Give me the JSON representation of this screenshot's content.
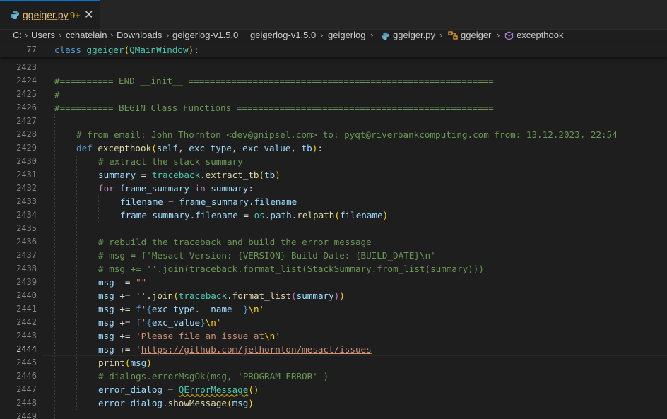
{
  "tab": {
    "filename": "ggeiger.py",
    "problems": "9+",
    "close": "✕"
  },
  "breadcrumb": {
    "segments": [
      "C:",
      "Users",
      "cchatelain",
      "Downloads",
      "geigerlog-v1.5.0",
      "geigerlog-v1.5.0",
      "geigerlog",
      "ggeiger.py",
      "ggeiger",
      "excepthook"
    ],
    "separator": "›"
  },
  "sticky": {
    "line_number": "77",
    "keyword": "class",
    "name": "ggeiger",
    "base": "QMainWindow",
    "open": "(",
    "close": "):"
  },
  "lines": {
    "l2423": {
      "n": "2423"
    },
    "l2424": {
      "n": "2424",
      "text": "#========== END __init__ ========================================================="
    },
    "l2425": {
      "n": "2425",
      "text": "#"
    },
    "l2426": {
      "n": "2426",
      "text": "#========== BEGIN Class Functions ================================================"
    },
    "l2427": {
      "n": "2427"
    },
    "l2428": {
      "n": "2428",
      "text": "# from email: John Thornton <dev@gnipsel.com> to: pyqt@riverbankcomputing.com from: 13.12.2023, 22:54"
    },
    "l2429": {
      "n": "2429",
      "def": "def",
      "name": "excepthook",
      "p1": "self",
      "p2": "exc_type",
      "p3": "exc_value",
      "p4": "tb"
    },
    "l2430": {
      "n": "2430",
      "text": "# extract the stack summary"
    },
    "l2431": {
      "n": "2431",
      "var": "summary",
      "mod": "traceback",
      "fn": "extract_tb",
      "arg": "tb"
    },
    "l2432": {
      "n": "2432",
      "for": "for",
      "var": "frame_summary",
      "in": "in",
      "iter": "summary"
    },
    "l2433": {
      "n": "2433",
      "a": "filename",
      "b": "frame_summary",
      "c": "filename"
    },
    "l2434": {
      "n": "2434",
      "a": "frame_summary",
      "b": "filename",
      "mod1": "os",
      "mod2": "path",
      "fn": "relpath",
      "arg": "filename"
    },
    "l2435": {
      "n": "2435"
    },
    "l2436": {
      "n": "2436",
      "text": "# rebuild the traceback and build the error message"
    },
    "l2437": {
      "n": "2437",
      "text": "# msg = f'Mesact Version: {VERSION} Build Date: {BUILD_DATE}\\n'"
    },
    "l2438": {
      "n": "2438",
      "text": "# msg += ''.join(traceback.format_list(StackSummary.from_list(summary)))"
    },
    "l2439": {
      "n": "2439",
      "var": "msg",
      "str": "\"\""
    },
    "l2440": {
      "n": "2440",
      "var": "msg",
      "str": "''",
      "fn1": "join",
      "mod": "traceback",
      "fn2": "format_list",
      "arg": "summary"
    },
    "l2441": {
      "n": "2441",
      "var": "msg",
      "f": "f",
      "q1": "'",
      "expr": "exc_type",
      "attr": "__name__",
      "esc": "\\n",
      "q2": "'"
    },
    "l2442": {
      "n": "2442",
      "var": "msg",
      "f": "f",
      "q1": "'",
      "expr": "exc_value",
      "esc": "\\n",
      "q2": "'"
    },
    "l2443": {
      "n": "2443",
      "var": "msg",
      "str": "'Please file an issue at",
      "esc": "\\n",
      "q2": "'"
    },
    "l2444": {
      "n": "2444",
      "var": "msg",
      "q1": "'",
      "url": "https://github.com/jethornton/mesact/issues",
      "q2": "'"
    },
    "l2445": {
      "n": "2445",
      "fn": "print",
      "arg": "msg"
    },
    "l2446": {
      "n": "2446",
      "text": "# dialogs.errorMsgOk(msg, 'PROGRAM ERROR' )"
    },
    "l2447": {
      "n": "2447",
      "var": "error_dialog",
      "cls": "QErrorMessage"
    },
    "l2448": {
      "n": "2448",
      "var": "error_dialog",
      "fn": "showMessage",
      "arg": "msg"
    },
    "l2449": {
      "n": "2449"
    }
  }
}
